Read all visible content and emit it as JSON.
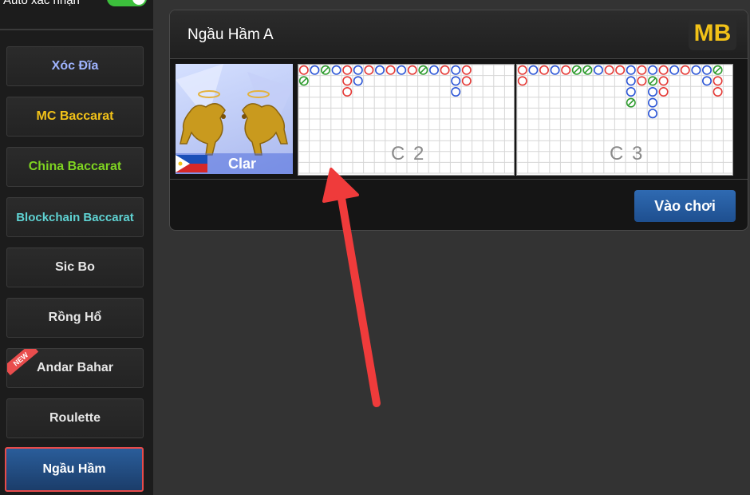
{
  "auto_confirm": {
    "label": "Auto xác nhận",
    "enabled": true
  },
  "sidebar": {
    "items": [
      {
        "label": "Xóc Đĩa",
        "color": "#9fb4ff"
      },
      {
        "label": "MC Baccarat",
        "color": "#f2c218"
      },
      {
        "label": "China Baccarat",
        "color": "#7ed321"
      },
      {
        "label": "Blockchain Baccarat",
        "color": "#5fd3d3"
      },
      {
        "label": "Sic Bo",
        "color": "#e6e6e6"
      },
      {
        "label": "Rồng Hổ",
        "color": "#e6e6e6"
      },
      {
        "label": "Andar Bahar",
        "color": "#e6e6e6",
        "badge": "NEW"
      },
      {
        "label": "Roulette",
        "color": "#e6e6e6"
      },
      {
        "label": "Ngầu Hầm",
        "color": "#ffffff",
        "active": true
      }
    ]
  },
  "game_card": {
    "title": "Ngầu Hầm A",
    "logo": "MB",
    "thumbnail": {
      "label": "Clar",
      "flag": "philippines-flag",
      "art": "golden-bulls"
    },
    "roads": [
      {
        "label": "C 2",
        "columns": [
          [
            "red",
            "green"
          ],
          [
            "blue"
          ],
          [
            "green"
          ],
          [
            "blue"
          ],
          [
            "red",
            "red",
            "red"
          ],
          [
            "blue",
            "blue"
          ],
          [
            "red"
          ],
          [
            "blue"
          ],
          [
            "red"
          ],
          [
            "blue"
          ],
          [
            "red"
          ],
          [
            "green"
          ],
          [
            "blue"
          ],
          [
            "red"
          ],
          [
            "blue",
            "blue",
            "blue"
          ],
          [
            "red",
            "red"
          ]
        ]
      },
      {
        "label": "C 3",
        "columns": [
          [
            "red",
            "red"
          ],
          [
            "blue"
          ],
          [
            "red"
          ],
          [
            "blue"
          ],
          [
            "red"
          ],
          [
            "green"
          ],
          [
            "green"
          ],
          [
            "blue"
          ],
          [
            "red"
          ],
          [
            "red"
          ],
          [
            "blue",
            "blue",
            "blue",
            "green"
          ],
          [
            "red",
            "red"
          ],
          [
            "blue",
            "green",
            "blue",
            "blue",
            "blue"
          ],
          [
            "red",
            "red",
            "red"
          ],
          [
            "blue"
          ],
          [
            "red"
          ],
          [
            "blue"
          ],
          [
            "blue",
            "blue"
          ],
          [
            "green",
            "red",
            "red"
          ]
        ]
      }
    ],
    "play_button": "Vào chơi"
  },
  "colors": {
    "accent_blue": "#1e4f8f",
    "banker_red": "#e53935",
    "player_blue": "#2b55d6",
    "tie_green": "#2e9b2e",
    "highlight_red": "#e84b4b"
  }
}
